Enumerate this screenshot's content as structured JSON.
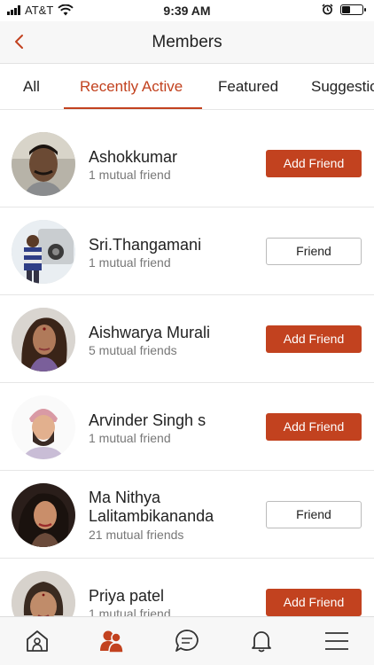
{
  "status_bar": {
    "carrier": "AT&T",
    "time": "9:39 AM",
    "battery_level": 0.45
  },
  "header": {
    "title": "Members"
  },
  "tabs": [
    {
      "label": "All",
      "active": false
    },
    {
      "label": "Recently Active",
      "active": true
    },
    {
      "label": "Featured",
      "active": false
    },
    {
      "label": "Suggestions",
      "active": false
    }
  ],
  "members": [
    {
      "name": "Ashokkumar",
      "mutual": "1 mutual friend",
      "button": "Add Friend"
    },
    {
      "name": "Sri.Thangamani",
      "mutual": "1 mutual friend",
      "button": "Friend"
    },
    {
      "name": "Aishwarya Murali",
      "mutual": "5 mutual friends",
      "button": "Add Friend"
    },
    {
      "name": "Arvinder Singh s",
      "mutual": "1 mutual friend",
      "button": "Add Friend"
    },
    {
      "name": "Ma Nithya Lalitambikananda",
      "mutual": "21 mutual friends",
      "button": "Friend"
    },
    {
      "name": "Priya patel",
      "mutual": "1 mutual friend",
      "button": "Add Friend"
    }
  ],
  "bottom_nav": [
    {
      "icon": "home-icon",
      "active": false
    },
    {
      "icon": "members-icon",
      "active": true
    },
    {
      "icon": "chat-icon",
      "active": false
    },
    {
      "icon": "bell-icon",
      "active": false
    },
    {
      "icon": "menu-icon",
      "active": false
    }
  ],
  "colors": {
    "accent": "#c2421f",
    "text": "#222222",
    "muted": "#777777"
  }
}
